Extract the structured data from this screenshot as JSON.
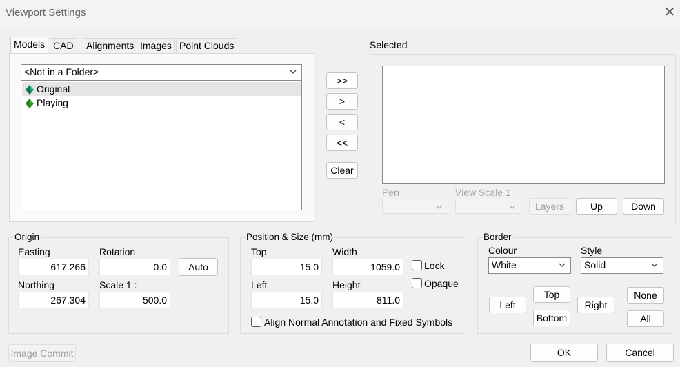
{
  "window": {
    "title": "Viewport Settings"
  },
  "tabs": [
    "Models",
    "CAD",
    "Alignments",
    "Images",
    "Point Clouds"
  ],
  "models": {
    "folder": "<Not in a Folder>",
    "items": [
      "Original",
      "Playing"
    ]
  },
  "transfer": {
    "add_all": ">>",
    "add": ">",
    "remove": "<",
    "remove_all": "<<",
    "clear": "Clear"
  },
  "selected": {
    "label": "Selected",
    "pen_label": "Pen",
    "view_scale_label": "View Scale 1:",
    "layers": "Layers",
    "up": "Up",
    "down": "Down"
  },
  "origin": {
    "title": "Origin",
    "easting_label": "Easting",
    "easting": "617.266",
    "rotation_label": "Rotation",
    "rotation": "0.0",
    "auto": "Auto",
    "northing_label": "Northing",
    "northing": "267.304",
    "scale_label": "Scale 1 :",
    "scale": "500.0"
  },
  "position": {
    "title": "Position & Size (mm)",
    "top_label": "Top",
    "top": "15.0",
    "width_label": "Width",
    "width": "1059.0",
    "left_label": "Left",
    "left": "15.0",
    "height_label": "Height",
    "height": "811.0",
    "lock": "Lock",
    "opaque": "Opaque",
    "align": "Align Normal Annotation and Fixed Symbols"
  },
  "border": {
    "title": "Border",
    "colour_label": "Colour",
    "colour": "White",
    "style_label": "Style",
    "style": "Solid",
    "top": "Top",
    "left": "Left",
    "right": "Right",
    "bottom": "Bottom",
    "none": "None",
    "all": "All"
  },
  "footer": {
    "image_commit": "Image Commit",
    "ok": "OK",
    "cancel": "Cancel"
  },
  "colors": {
    "tin_dark": "#0f7a5a",
    "tin_light": "#2bb37e",
    "tin_green_dark": "#1e7d1e",
    "tin_green_light": "#4cc03c"
  }
}
